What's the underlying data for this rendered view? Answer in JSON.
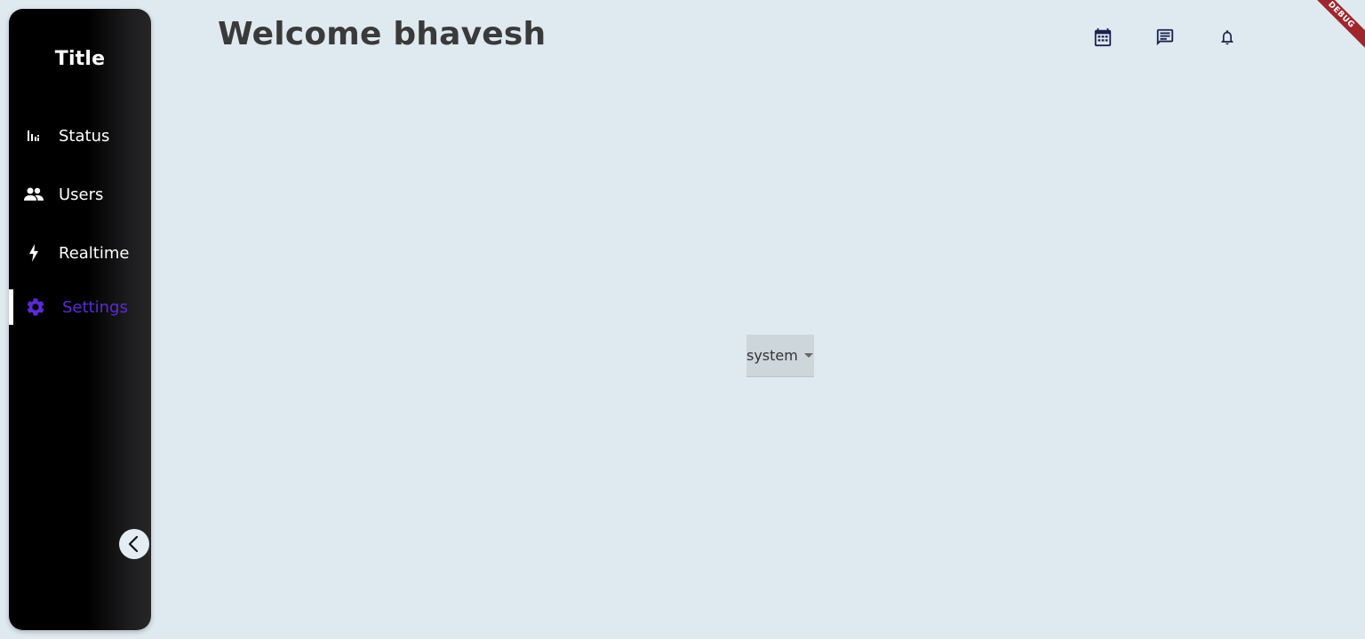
{
  "sidebar": {
    "title": "Title",
    "items": [
      {
        "label": "Status",
        "icon": "bar-chart-icon"
      },
      {
        "label": "Users",
        "icon": "people-icon"
      },
      {
        "label": "Realtime",
        "icon": "bolt-icon"
      },
      {
        "label": "Settings",
        "icon": "gear-icon",
        "active": true
      }
    ],
    "collapse_icon": "chevron-left-icon"
  },
  "header": {
    "title": "Welcome bhavesh",
    "icons": [
      "calendar-icon",
      "chat-icon",
      "bell-icon"
    ]
  },
  "main": {
    "dropdown": {
      "selected": "system"
    }
  },
  "debug_banner": "DEBUG",
  "colors": {
    "background": "#dfeaf0",
    "sidebar_bg": "#000000",
    "active_accent": "#5b2bd6",
    "header_icon": "#1a2350",
    "title_text": "#3a3a3a",
    "debug_banner": "#a0262e"
  }
}
